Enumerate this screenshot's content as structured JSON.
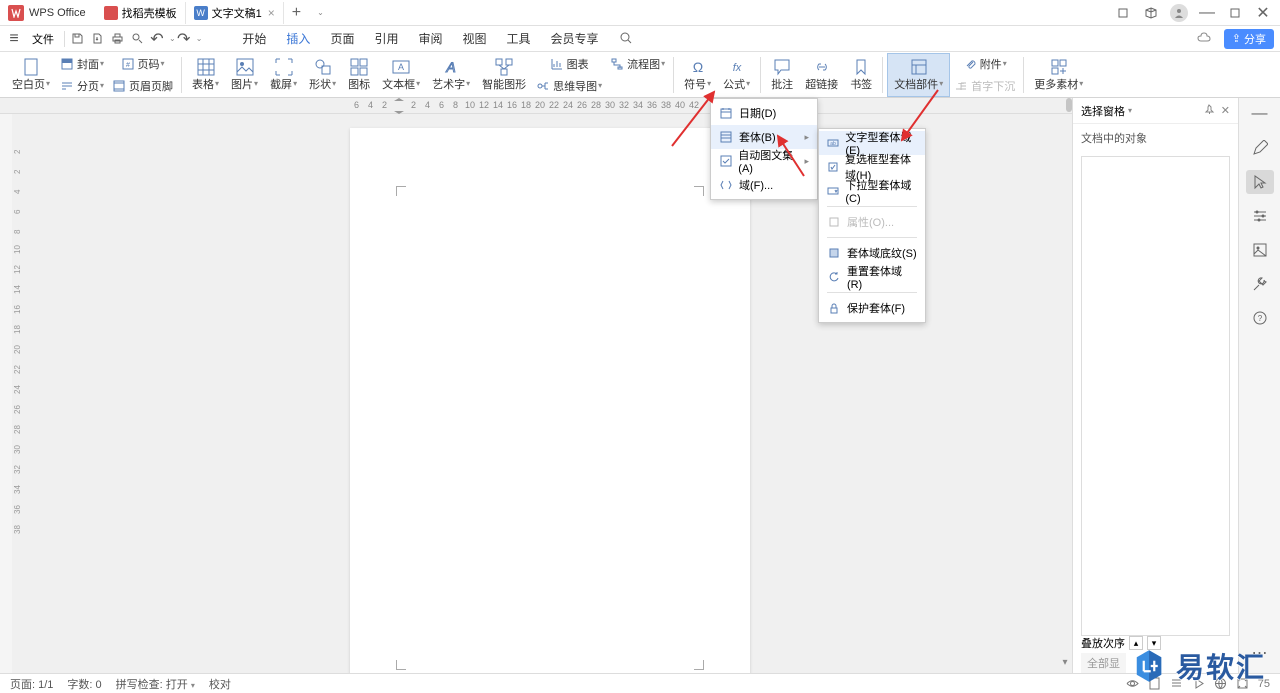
{
  "app": {
    "name": "WPS Office"
  },
  "tabs": [
    {
      "label": "找稻壳模板"
    },
    {
      "label": "文字文稿1"
    }
  ],
  "menu": {
    "file": "文件",
    "tabs": [
      "开始",
      "插入",
      "页面",
      "引用",
      "审阅",
      "视图",
      "工具",
      "会员专享"
    ],
    "share": "分享"
  },
  "ribbon": {
    "blank": "空白页",
    "cover": "封面",
    "pagenum": "页码",
    "section": "分页",
    "headerfooter": "页眉页脚",
    "table": "表格",
    "picture": "图片",
    "screenshot": "截屏",
    "shape": "形状",
    "icon": "图标",
    "textbox": "文本框",
    "wordart": "艺术字",
    "smartart": "智能图形",
    "chart": "图表",
    "flowchart": "流程图",
    "mindmap": "思维导图",
    "symbol": "符号",
    "equation": "公式",
    "comment": "批注",
    "hyperlink": "超链接",
    "bookmark": "书签",
    "quickparts": "文档部件",
    "attachment": "附件",
    "dropcap": "首字下沉",
    "more": "更多素材"
  },
  "dropdown1": {
    "date": "日期(D)",
    "form": "套体(B)",
    "autotext": "自动图文集(A)",
    "field": "域(F)..."
  },
  "dropdown2": {
    "text_form": "文字型套体域(E)",
    "checkbox_form": "复选框型套体域(H)",
    "dropdown_form": "下拉型套体域(C)",
    "properties": "属性(O)...",
    "shading": "套体域底纹(S)",
    "reset": "重置套体域(R)",
    "protect": "保护套体(F)"
  },
  "right_panel": {
    "title": "选择窗格",
    "subtitle": "文档中的对象",
    "stack": "叠放次序",
    "all": "全部显"
  },
  "status": {
    "page": "页面: 1/1",
    "words": "字数: 0",
    "spell": "拼写检查: 打开",
    "proof": "校对",
    "zoom": "75"
  },
  "watermark": "易软汇"
}
